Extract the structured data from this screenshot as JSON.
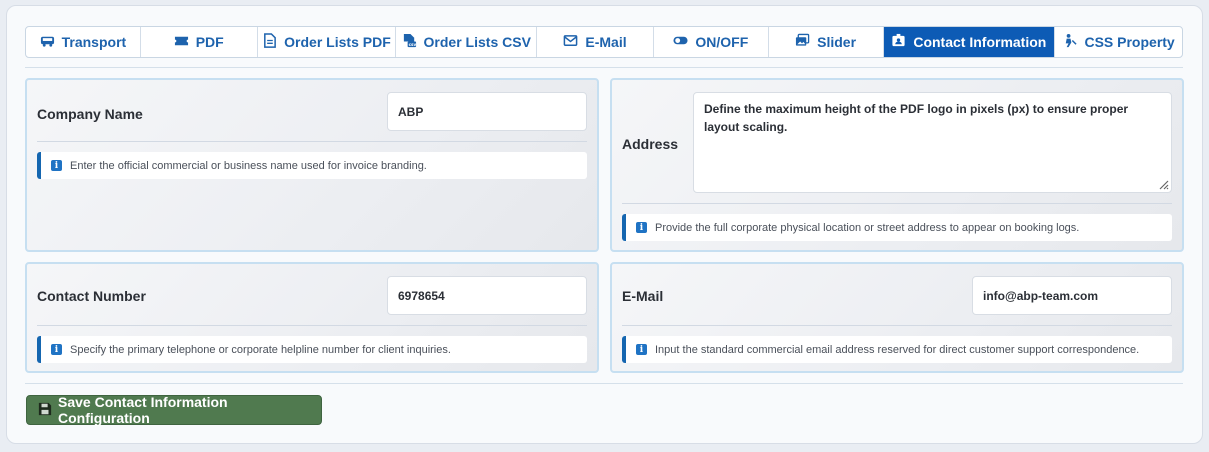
{
  "tabs": [
    {
      "label": "Transport",
      "icon": "bus-icon"
    },
    {
      "label": "PDF",
      "icon": "ticket-icon"
    },
    {
      "label": "Order Lists PDF",
      "icon": "document-icon"
    },
    {
      "label": "Order Lists CSV",
      "icon": "csv-file-icon"
    },
    {
      "label": "E-Mail",
      "icon": "envelope-icon"
    },
    {
      "label": "ON/OFF",
      "icon": "toggle-icon"
    },
    {
      "label": "Slider",
      "icon": "images-icon"
    },
    {
      "label": "Contact Information",
      "icon": "id-badge-icon"
    },
    {
      "label": "CSS Property",
      "icon": "css-icon"
    }
  ],
  "active_tab": "Contact Information",
  "fields": {
    "company": {
      "label": "Company Name",
      "value": "ABP",
      "hint": "Enter the official commercial or business name used for invoice branding."
    },
    "address": {
      "label": "Address",
      "value": "Define the maximum height of the PDF logo in pixels (px) to ensure proper layout scaling.",
      "hint": "Provide the full corporate physical location or street address to appear on booking logs."
    },
    "contact": {
      "label": "Contact Number",
      "value": "6978654",
      "hint": "Specify the primary telephone or corporate helpline number for client inquiries."
    },
    "email": {
      "label": "E-Mail",
      "value": "info@abp-team.com",
      "hint": "Input the standard commercial email address reserved for direct customer support correspondence."
    }
  },
  "info_glyph": "i",
  "save_button": {
    "label": "Save Contact Information Configuration",
    "icon": "floppy-disk-icon"
  },
  "colors": {
    "accent": "#0d5bb5",
    "save": "#507a4f",
    "hint_border": "#1566b0"
  }
}
